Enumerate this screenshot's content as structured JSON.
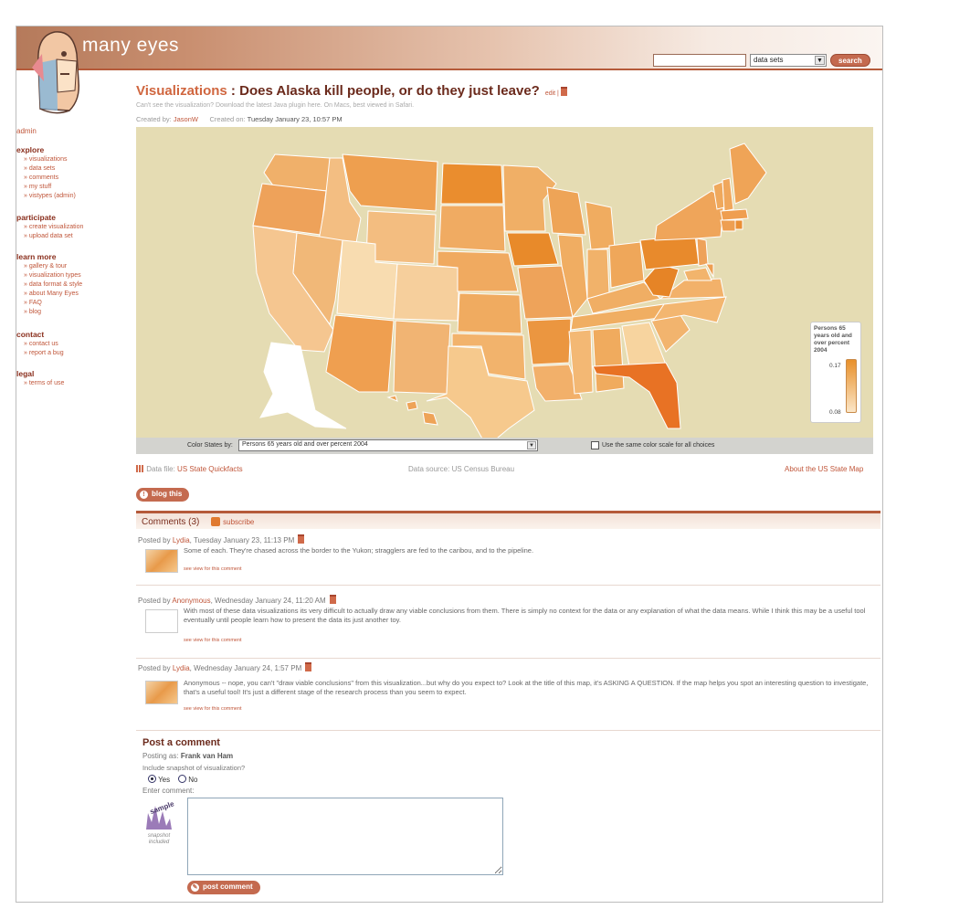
{
  "header": {
    "site_name": "many eyes",
    "search_value": "",
    "search_scope": "data sets",
    "search_button": "search"
  },
  "sidebar": {
    "admin": "admin",
    "groups": [
      {
        "title": "explore",
        "items": [
          "» visualizations",
          "» data sets",
          "» comments",
          "» my stuff",
          "» vistypes (admin)"
        ]
      },
      {
        "title": "participate",
        "items": [
          "» create visualization",
          "» upload data set"
        ]
      },
      {
        "title": "learn more",
        "items": [
          "» gallery & tour",
          "» visualization types",
          "» data format & style",
          "» about Many Eyes",
          "» FAQ",
          "» blog"
        ]
      },
      {
        "title": "contact",
        "items": [
          "» contact us",
          "» report a bug"
        ]
      },
      {
        "title": "legal",
        "items": [
          "» terms of use"
        ]
      }
    ]
  },
  "viz": {
    "section": "Visualizations",
    "sep": " : ",
    "title": "Does Alaska kill people, or do they just leave?",
    "edit": "edit |",
    "java_note": "Can't see the visualization? Download the latest Java plugin here. On Macs, best viewed in Safari.",
    "created_by_label": "Created by:",
    "created_by": "JasonW",
    "created_on_label": "Created on:",
    "created_on": "Tuesday January 23, 10:57 PM"
  },
  "map": {
    "legend_title": "Persons 65 years old and over percent 2004",
    "legend_max": "0.17",
    "legend_min": "0.08",
    "color_label": "Color States by:",
    "color_value": "Persons 65 years old and over percent 2004",
    "same_scale_label": "Use the same color scale for all choices",
    "same_scale_checked": false,
    "colors": {
      "high": "#e8902a",
      "low": "#fbe6c8",
      "background": "#e5dcb3"
    }
  },
  "data_row": {
    "data_file_label": "Data file:",
    "data_file": "US State Quickfacts",
    "data_source": "Data source: US Census Bureau",
    "about_map": "About the US State Map",
    "blog_this": "blog this"
  },
  "comments": {
    "header": "Comments (3)",
    "subscribe": "subscribe",
    "items": [
      {
        "posted_by": "Posted by",
        "author": "Lydia",
        "date": ", Tuesday January 23, 11:13 PM",
        "text": "Some of each. They're chased across the border to the Yukon; stragglers are fed to the caribou, and to the pipeline.",
        "link": "see view for this comment"
      },
      {
        "posted_by": "Posted by",
        "author": "Anonymous",
        "date": ", Wednesday January 24, 11:20 AM",
        "text": "With most of these data visualizations its very difficult to actually draw any viable conclusions from them. There is simply no context for the data or any explanation of what the data means. While I think this may be a useful tool eventually until people learn how to present the data its just another toy.",
        "link": "see view for this comment"
      },
      {
        "posted_by": "Posted by",
        "author": "Lydia",
        "date": ", Wednesday January 24, 1:57 PM",
        "text": "Anonymous -- nope, you can't \"draw viable conclusions\" from this visualization...but why do you expect to? Look at the title of this map, it's ASKING A QUESTION. If the map helps you spot an interesting question to investigate, that's a useful tool! It's just a different stage of the research process than you seem to expect.",
        "link": "see view for this comment"
      }
    ]
  },
  "post": {
    "title": "Post a comment",
    "posting_as_label": "Posting as:",
    "posting_as": "Frank van Ham",
    "include_label": "Include snapshot of visualization?",
    "yes": "Yes",
    "no": "No",
    "include_selected": "Yes",
    "enter_label": "Enter comment:",
    "sample": "sample",
    "snapshot_note": "snapshot included",
    "comment_value": "",
    "submit": "post comment"
  }
}
